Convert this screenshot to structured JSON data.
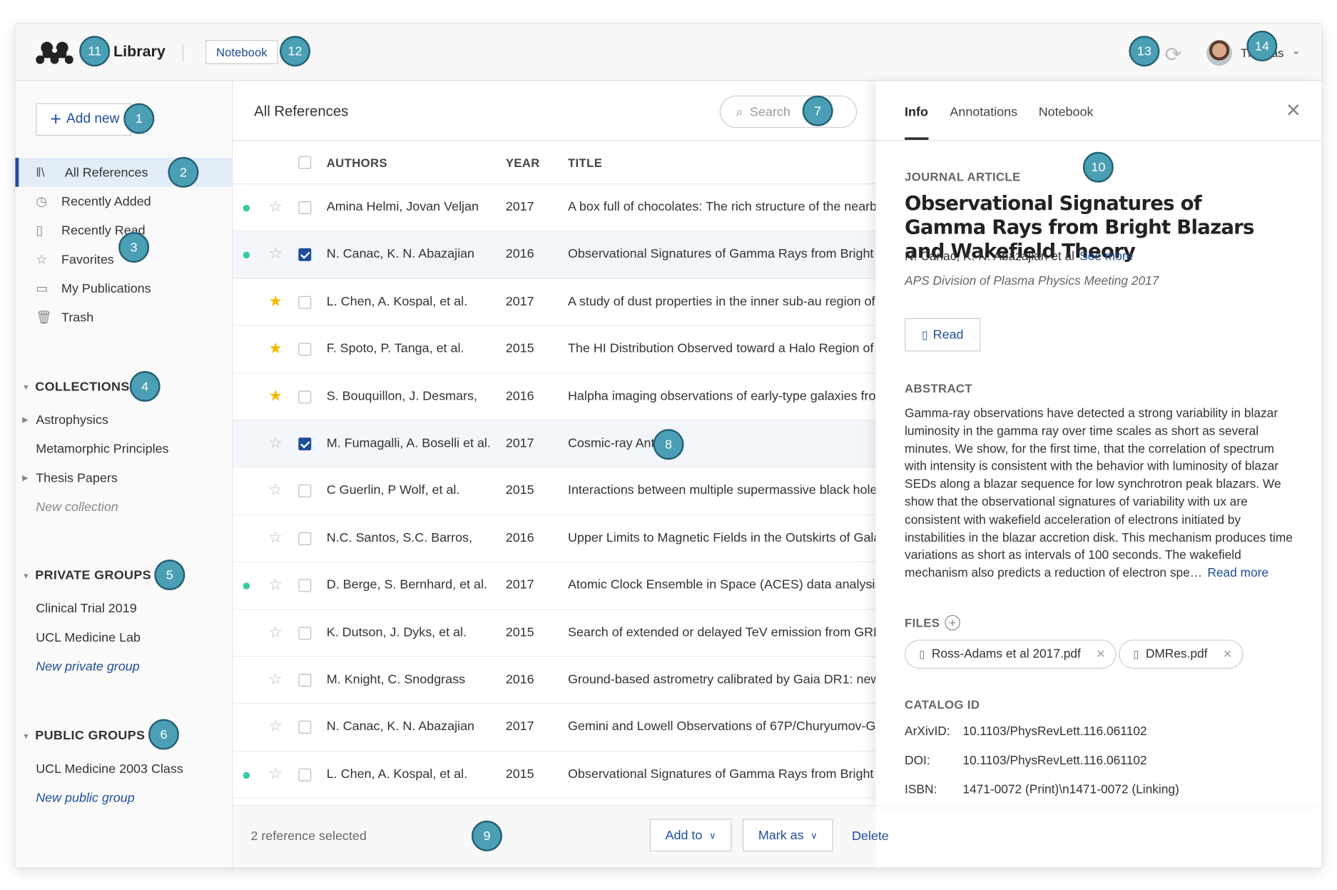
{
  "header": {
    "app_title": "Library",
    "notebook_button": "Notebook",
    "user_name": "Thomas",
    "icons": {
      "logo": "mendeley-logo",
      "sync": "sync-icon",
      "chevron": "chevron-down-icon"
    }
  },
  "sidebar": {
    "add_new": "Add new",
    "nav": [
      {
        "label": "All References",
        "icon": "library-icon",
        "active": true
      },
      {
        "label": "Recently Added",
        "icon": "clock-icon"
      },
      {
        "label": "Recently Read",
        "icon": "bookmark-icon"
      },
      {
        "label": "Favorites",
        "icon": "star-icon"
      },
      {
        "label": "My Publications",
        "icon": "publication-icon"
      },
      {
        "label": "Trash",
        "icon": "trash-icon"
      }
    ],
    "collections": {
      "heading": "COLLECTIONS",
      "items": [
        "Astrophysics",
        "Metamorphic Principles",
        "Thesis Papers"
      ],
      "new": "New collection"
    },
    "private_groups": {
      "heading": "PRIVATE GROUPS",
      "items": [
        "Clinical Trial 2019",
        "UCL Medicine Lab"
      ],
      "new": "New private group"
    },
    "public_groups": {
      "heading": "PUBLIC GROUPS",
      "items": [
        "UCL Medicine 2003 Class"
      ],
      "new": "New public group"
    }
  },
  "main": {
    "title": "All References",
    "search_placeholder": "Search",
    "columns": {
      "authors": "AUTHORS",
      "year": "YEAR",
      "title": "TITLE"
    },
    "rows": [
      {
        "unread": true,
        "starred": false,
        "checked": false,
        "authors": "Amina Helmi, Jovan Veljan",
        "year": "2017",
        "title": "A box full of chocolates: The rich structure of the nearby"
      },
      {
        "unread": true,
        "starred": false,
        "checked": true,
        "authors": "N. Canac, K. N. Abazajian",
        "year": "2016",
        "title": "Observational Signatures of Gamma Rays from Bright Blazars"
      },
      {
        "unread": false,
        "starred": true,
        "checked": false,
        "authors": "L. Chen, A. Kospal, et al.",
        "year": "2017",
        "title": "A study of dust properties in the inner sub-au region of"
      },
      {
        "unread": false,
        "starred": true,
        "checked": false,
        "authors": "F. Spoto, P. Tanga, et al.",
        "year": "2015",
        "title": "The HI Distribution Observed toward a Halo Region of"
      },
      {
        "unread": false,
        "starred": true,
        "checked": false,
        "authors": "S. Bouquillon, J. Desmars,",
        "year": "2016",
        "title": "Halpha imaging observations of early-type galaxies from"
      },
      {
        "unread": false,
        "starred": false,
        "checked": true,
        "authors": "M. Fumagalli, A. Boselli et al.",
        "year": "2017",
        "title": "Cosmic-ray Anti er"
      },
      {
        "unread": false,
        "starred": false,
        "checked": false,
        "authors": "C Guerlin, P Wolf, et al.",
        "year": "2015",
        "title": "Interactions between multiple supermassive black holes"
      },
      {
        "unread": false,
        "starred": false,
        "checked": false,
        "authors": "N.C. Santos, S.C. Barros,",
        "year": "2016",
        "title": "Upper Limits to Magnetic Fields in the Outskirts of Galaxy"
      },
      {
        "unread": true,
        "starred": false,
        "checked": false,
        "authors": "D. Berge, S. Bernhard, et al.",
        "year": "2017",
        "title": "Atomic Clock Ensemble in Space (ACES) data analysis"
      },
      {
        "unread": false,
        "starred": false,
        "checked": false,
        "authors": "K. Dutson, J. Dyks, et al.",
        "year": "2015",
        "title": "Search of extended or delayed TeV emission from GRBs"
      },
      {
        "unread": false,
        "starred": false,
        "checked": false,
        "authors": "M. Knight, C. Snodgrass",
        "year": "2016",
        "title": "Ground-based astrometry calibrated by Gaia DR1: new"
      },
      {
        "unread": false,
        "starred": false,
        "checked": false,
        "authors": "N. Canac, K. N. Abazajian",
        "year": "2017",
        "title": "Gemini and Lowell Observations of 67P/Churyumov-Gerasimenko"
      },
      {
        "unread": true,
        "starred": false,
        "checked": false,
        "authors": "L. Chen, A. Kospal, et al.",
        "year": "2015",
        "title": "Observational Signatures of Gamma Rays from Bright Blazars"
      }
    ],
    "footer": {
      "selected": "2 reference selected",
      "add_to": "Add to",
      "mark_as": "Mark as",
      "delete": "Delete"
    }
  },
  "panel": {
    "tabs": [
      "Info",
      "Annotations",
      "Notebook"
    ],
    "active_tab": "Info",
    "type": "JOURNAL ARTICLE",
    "title": "Observational Signatures of Gamma Rays from Bright Blazars and Wakefield Theory",
    "authors": "N. Canac, K. N. Abazajian et al",
    "see_more": "See more",
    "journal": "APS Division of Plasma Physics Meeting 2017",
    "read_button": "Read",
    "abstract_label": "ABSTRACT",
    "abstract": "Gamma-ray observations have detected a strong variability in blazar luminosity in the gamma ray over time scales as short as several minutes. We show, for the first time, that the correlation of spectrum with intensity is consistent with the behavior with luminosity of blazar SEDs along a blazar sequence for low synchrotron peak blazars. We show that the observational signatures of variability with ux are consistent with wakefield acceleration of electrons initiated by instabilities in the blazar accretion disk. This mechanism produces time variations as short as intervals of 100 seconds. The wakefield mechanism also predicts a reduction of electron spe…",
    "read_more": "Read more",
    "files_label": "FILES",
    "files": [
      "Ross-Adams et al 2017.pdf",
      "DMRes.pdf"
    ],
    "catalog_label": "CATALOG ID",
    "catalog": [
      {
        "k": "ArXivID:",
        "v": "10.1103/PhysRevLett.116.061102"
      },
      {
        "k": "DOI:",
        "v": "10.1103/PhysRevLett.116.061102"
      },
      {
        "k": "ISBN:",
        "v": "1471-0072 (Print)\\n1471-0072 (Linking)"
      }
    ]
  },
  "callouts": [
    "1",
    "2",
    "3",
    "4",
    "5",
    "6",
    "7",
    "8",
    "9",
    "10",
    "11",
    "12",
    "13",
    "14"
  ],
  "colors": {
    "accent": "#1f4e9a",
    "callout": "#4a9fb5",
    "unread_dot": "#3cc9a8",
    "star": "#f5b800",
    "selected_row": "#f3f6fb",
    "active_nav": "#e3ecf9"
  }
}
